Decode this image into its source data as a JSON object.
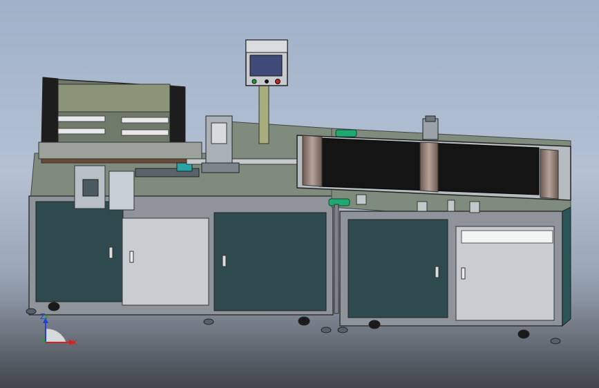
{
  "viewport": {
    "name": "cad-3d-viewport",
    "triad": {
      "x_label": "X",
      "y_label": "Y",
      "z_label": "Z"
    }
  },
  "colors": {
    "background_top": "#9fb0c8",
    "cabinet_frame": "#8e949a",
    "cabinet_door_dark": "#2f4a4f",
    "cabinet_door_light": "#c9cdcf",
    "table_top": "#7f8b7c",
    "conveyor_belt": "#141414",
    "hmi_screen": "#3f4a78",
    "accent_green": "#1fa870",
    "axis_x": "#d42020",
    "axis_y": "#20a020",
    "axis_z": "#2040d0"
  }
}
